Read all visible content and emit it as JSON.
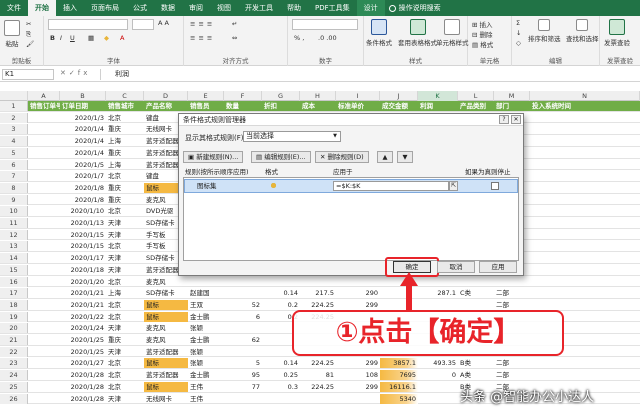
{
  "ribbon_tabs": [
    {
      "label": "文件",
      "active": false
    },
    {
      "label": "开始",
      "active": true
    },
    {
      "label": "插入",
      "active": false
    },
    {
      "label": "页面布局",
      "active": false
    },
    {
      "label": "公式",
      "active": false
    },
    {
      "label": "数据",
      "active": false
    },
    {
      "label": "审阅",
      "active": false
    },
    {
      "label": "视图",
      "active": false
    },
    {
      "label": "开发工具",
      "active": false
    },
    {
      "label": "帮助",
      "active": false
    },
    {
      "label": "PDF工具集",
      "active": false
    },
    {
      "label": "设计",
      "active": false
    }
  ],
  "tell_me": "操作说明搜索",
  "ribbon": {
    "paste": "粘贴",
    "clipboard": "剪贴板",
    "font": "字体",
    "align": "对齐方式",
    "number": "数字",
    "style": "样式",
    "cond_format": "条件格式",
    "table_format": "套用表格格式",
    "cell_style": "单元格样式",
    "insert": "插入",
    "delete": "删除",
    "format": "格式",
    "cells": "单元格",
    "sort_filter": "排序和筛选",
    "find_select": "查找和选择",
    "edit": "编辑",
    "send_invoice": "发票查验",
    "send_invoice2": "发票查验"
  },
  "formula_bar": {
    "name_box": "K1",
    "value": "利润"
  },
  "columns": [
    "A",
    "B",
    "C",
    "D",
    "E",
    "F",
    "G",
    "H",
    "I",
    "J",
    "K",
    "L",
    "M",
    "N"
  ],
  "header_row": [
    "销售订单号",
    "订单日期",
    "销售城市",
    "产品名称",
    "销售员",
    "数量",
    "折扣",
    "成本",
    "标准单价",
    "成交金额",
    "利润",
    "产品类别",
    "部门",
    "投入系统时间"
  ],
  "rows": [
    {
      "n": "2",
      "date": "2020/1/3",
      "city": "北京",
      "prod": "键盘",
      "hl": false,
      "sales": "",
      "qty": "",
      "disc": "",
      "cost": "",
      "price": "",
      "amt": "",
      "profit": "",
      "cat": "",
      "dept": ""
    },
    {
      "n": "3",
      "date": "2020/1/4",
      "city": "重庆",
      "prod": "无线网卡",
      "hl": false,
      "sales": "",
      "qty": "",
      "disc": "",
      "cost": "",
      "price": "",
      "amt": "",
      "profit": "",
      "cat": "",
      "dept": ""
    },
    {
      "n": "4",
      "date": "2020/1/4",
      "city": "上海",
      "prod": "蓝牙适配器",
      "hl": false,
      "sales": "",
      "qty": "",
      "disc": "",
      "cost": "",
      "price": "",
      "amt": "",
      "profit": "",
      "cat": "",
      "dept": ""
    },
    {
      "n": "5",
      "date": "2020/1/4",
      "city": "重庆",
      "prod": "蓝牙适配器",
      "hl": false,
      "sales": "",
      "qty": "",
      "disc": "",
      "cost": "",
      "price": "",
      "amt": "",
      "profit": "",
      "cat": "",
      "dept": ""
    },
    {
      "n": "6",
      "date": "2020/1/5",
      "city": "上海",
      "prod": "蓝牙适配器",
      "hl": false,
      "sales": "",
      "qty": "",
      "disc": "",
      "cost": "",
      "price": "",
      "amt": "",
      "profit": "",
      "cat": "",
      "dept": ""
    },
    {
      "n": "7",
      "date": "2020/1/7",
      "city": "北京",
      "prod": "键盘",
      "hl": false,
      "sales": "",
      "qty": "",
      "disc": "",
      "cost": "",
      "price": "",
      "amt": "",
      "profit": "",
      "cat": "",
      "dept": ""
    },
    {
      "n": "8",
      "date": "2020/1/8",
      "city": "重庆",
      "prod": "鼠标",
      "hl": true,
      "sales": "",
      "qty": "",
      "disc": "",
      "cost": "",
      "price": "",
      "amt": "",
      "profit": "",
      "cat": "",
      "dept": ""
    },
    {
      "n": "9",
      "date": "2020/1/8",
      "city": "重庆",
      "prod": "麦克风",
      "hl": false,
      "sales": "",
      "qty": "",
      "disc": "",
      "cost": "",
      "price": "",
      "amt": "",
      "profit": "",
      "cat": "",
      "dept": ""
    },
    {
      "n": "10",
      "date": "2020/1/10",
      "city": "北京",
      "prod": "DVD光驱",
      "hl": false,
      "sales": "",
      "qty": "",
      "disc": "",
      "cost": "",
      "price": "",
      "amt": "",
      "profit": "",
      "cat": "",
      "dept": ""
    },
    {
      "n": "11",
      "date": "2020/1/13",
      "city": "天津",
      "prod": "SD存储卡",
      "hl": false,
      "sales": "",
      "qty": "",
      "disc": "",
      "cost": "",
      "price": "",
      "amt": "",
      "profit": "",
      "cat": "",
      "dept": ""
    },
    {
      "n": "12",
      "date": "2020/1/15",
      "city": "天津",
      "prod": "手写板",
      "hl": false,
      "sales": "",
      "qty": "",
      "disc": "",
      "cost": "",
      "price": "",
      "amt": "",
      "profit": "",
      "cat": "",
      "dept": ""
    },
    {
      "n": "13",
      "date": "2020/1/15",
      "city": "北京",
      "prod": "手写板",
      "hl": false,
      "sales": "",
      "qty": "",
      "disc": "",
      "cost": "",
      "price": "",
      "amt": "",
      "profit": "",
      "cat": "",
      "dept": ""
    },
    {
      "n": "14",
      "date": "2020/1/17",
      "city": "天津",
      "prod": "SD存储卡",
      "hl": false,
      "sales": "",
      "qty": "",
      "disc": "",
      "cost": "",
      "price": "",
      "amt": "",
      "profit": "",
      "cat": "",
      "dept": ""
    },
    {
      "n": "15",
      "date": "2020/1/18",
      "city": "天津",
      "prod": "蓝牙适配器",
      "hl": false,
      "sales": "",
      "qty": "",
      "disc": "",
      "cost": "",
      "price": "",
      "amt": "",
      "profit": "",
      "cat": "",
      "dept": ""
    },
    {
      "n": "16",
      "date": "2020/1/20",
      "city": "北京",
      "prod": "麦克风",
      "hl": false,
      "sales": "",
      "qty": "",
      "disc": "",
      "cost": "",
      "price": "",
      "amt": "",
      "profit": "",
      "cat": "",
      "dept": ""
    },
    {
      "n": "17",
      "date": "2020/1/21",
      "city": "上海",
      "prod": "SD存储卡",
      "hl": false,
      "sales": "赵建国",
      "qty": "",
      "disc": "0.14",
      "cost": "217.5",
      "price": "290",
      "amt": "",
      "profit": "287.1",
      "cat": "C类",
      "dept": "二部"
    },
    {
      "n": "18",
      "date": "2020/1/21",
      "city": "北京",
      "prod": "鼠标",
      "hl": true,
      "sales": "王双",
      "qty": "52",
      "disc": "0.2",
      "cost": "224.25",
      "price": "299",
      "amt": "",
      "profit": "",
      "cat": "",
      "dept": "二部"
    },
    {
      "n": "19",
      "date": "2020/1/22",
      "city": "北京",
      "prod": "鼠标",
      "hl": true,
      "sales": "金士鹏",
      "qty": "6",
      "disc": "0.2",
      "cost": "224.25",
      "price": "",
      "amt": "",
      "profit": "",
      "cat": "",
      "dept": ""
    },
    {
      "n": "20",
      "date": "2020/1/24",
      "city": "天津",
      "prod": "麦克风",
      "hl": false,
      "sales": "张颖",
      "qty": "",
      "disc": "",
      "cost": "",
      "price": "",
      "amt": "",
      "profit": "",
      "cat": "",
      "dept": ""
    },
    {
      "n": "21",
      "date": "2020/1/25",
      "city": "重庆",
      "prod": "麦克风",
      "hl": false,
      "sales": "金士鹏",
      "qty": "62",
      "disc": "",
      "cost": "",
      "price": "",
      "amt": "",
      "profit": "",
      "cat": "",
      "dept": ""
    },
    {
      "n": "22",
      "date": "2020/1/25",
      "city": "天津",
      "prod": "蓝牙适配器",
      "hl": false,
      "sales": "张颖",
      "qty": "",
      "disc": "",
      "cost": "",
      "price": "",
      "amt": "",
      "profit": "",
      "cat": "",
      "dept": ""
    },
    {
      "n": "23",
      "date": "2020/1/27",
      "city": "北京",
      "prod": "鼠标",
      "hl": true,
      "sales": "张颖",
      "qty": "5",
      "disc": "0.14",
      "cost": "224.25",
      "price": "299",
      "amt": "3857.1",
      "profit": "493.35",
      "cat": "B类",
      "dept": "二部"
    },
    {
      "n": "24",
      "date": "2020/1/28",
      "city": "北京",
      "prod": "蓝牙适配器",
      "hl": false,
      "sales": "金士鹏",
      "qty": "95",
      "disc": "0.25",
      "cost": "81",
      "price": "108",
      "amt": "7695",
      "profit": "0",
      "cat": "A类",
      "dept": "二部"
    },
    {
      "n": "25",
      "date": "2020/1/28",
      "city": "北京",
      "prod": "鼠标",
      "hl": true,
      "sales": "王伟",
      "qty": "77",
      "disc": "0.3",
      "cost": "224.25",
      "price": "299",
      "amt": "16116.1",
      "profit": "",
      "cat": "B类",
      "dept": "二部"
    },
    {
      "n": "26",
      "date": "2020/1/28",
      "city": "天津",
      "prod": "无线网卡",
      "hl": false,
      "sales": "王伟",
      "qty": "",
      "disc": "",
      "cost": "",
      "price": "",
      "amt": "5340",
      "profit": "",
      "cat": "",
      "dept": ""
    }
  ],
  "dialog": {
    "title": "条件格式规则管理器",
    "show_label": "显示其格式规则(F):",
    "show_value": "当前选择",
    "new_rule": "新建规则(N)...",
    "edit_rule": "编辑规则(E)...",
    "delete_rule": "删除规则(D)",
    "col_rule": "规则(按所示顺序应用)",
    "col_format": "格式",
    "col_applies": "应用于",
    "col_stop": "如果为真则停止",
    "rule_name": "图标集",
    "applies_to": "=$K:$K",
    "ok": "确定",
    "cancel": "取消",
    "apply": "应用"
  },
  "callout": "①点击【确定】",
  "watermark": "头条 @智能办公小达人",
  "accent": "#217346",
  "highlight": "#e8242a"
}
